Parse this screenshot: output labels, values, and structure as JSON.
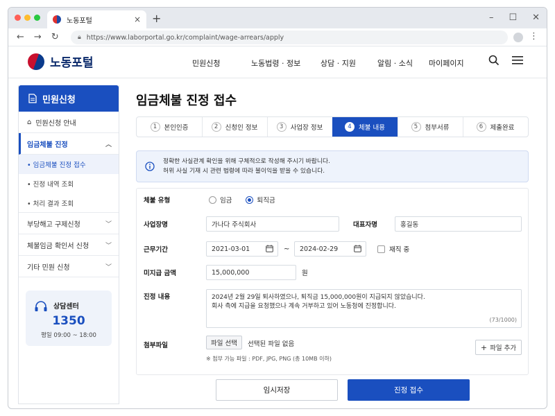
{
  "browser": {
    "tab_title": "노동포털",
    "url": "https://www.laborportal.go.kr/complaint/wage-arrears/apply",
    "traffic_lights": [
      "#ff5f57",
      "#febc2e",
      "#28c840"
    ]
  },
  "header": {
    "logo": "노동포털",
    "nav": [
      "민원신청",
      "노동법령 · 정보",
      "상담 · 지원",
      "알림 · 소식",
      "마이페이지"
    ]
  },
  "sidebar": {
    "title": "민원신청",
    "items": [
      {
        "label": "민원신청 안내"
      },
      {
        "label": "임금체불 진정"
      },
      {
        "label": "부당해고 구제신청"
      },
      {
        "label": "체불임금 확인서 신청"
      },
      {
        "label": "기타 민원 신청"
      }
    ],
    "subitems": [
      "• 임금체불 진정 접수",
      "• 진정 내역 조회",
      "• 처리 결과 조회"
    ],
    "help": {
      "label": "상담센터",
      "number": "1350",
      "hours": "평일 09:00 ~ 18:00"
    }
  },
  "main": {
    "title": "임금체불 진정 접수",
    "steps": [
      {
        "n": "1",
        "label": "본인인증"
      },
      {
        "n": "2",
        "label": "신청인 정보"
      },
      {
        "n": "3",
        "label": "사업장 정보"
      },
      {
        "n": "4",
        "label": "체불 내용"
      },
      {
        "n": "5",
        "label": "첨부서류"
      },
      {
        "n": "6",
        "label": "제출완료"
      }
    ],
    "current_step": 4,
    "notice_line1": "정확한 사실관계 확인을 위해 구체적으로 작성해 주시기 바랍니다.",
    "notice_line2": "허위 사실 기재 시 관련 법령에 따라 불이익을 받을 수 있습니다.",
    "form": {
      "type_label": "체불 유형",
      "type_options": [
        "임금",
        "퇴직금"
      ],
      "type_selected": "퇴직금",
      "company_label": "사업장명",
      "company_value": "가나다 주식회사",
      "ceo_label": "대표자명",
      "ceo_value": "홍길동",
      "period_label": "근무기간",
      "start_date": "2021-03-01",
      "tilde": "~",
      "end_date": "2024-02-29",
      "employed_label": "재직 중",
      "unpaid_label": "미지급 금액",
      "unpaid_value": "15,000,000",
      "unit": "원",
      "content_label": "진정 내용",
      "content_line1": "2024년 2월 29일 퇴사하였으나, 퇴직금 15,000,000원이 지급되지 않았습니다.",
      "content_line2": "회사 측에 지급을 요청했으나 계속 거부하고 있어 노동청에 진정합니다.",
      "content_counter": "(73/1000)",
      "file_label": "첨부파일",
      "file_button": "파일 선택",
      "file_status": "선택된 파일 없음",
      "add_file": "파일 추가",
      "file_hint": "※ 첨부 가능 파일 : PDF, JPG, PNG (총 10MB 이하)"
    },
    "buttons": {
      "save": "임시저장",
      "submit": "진정 접수"
    }
  }
}
